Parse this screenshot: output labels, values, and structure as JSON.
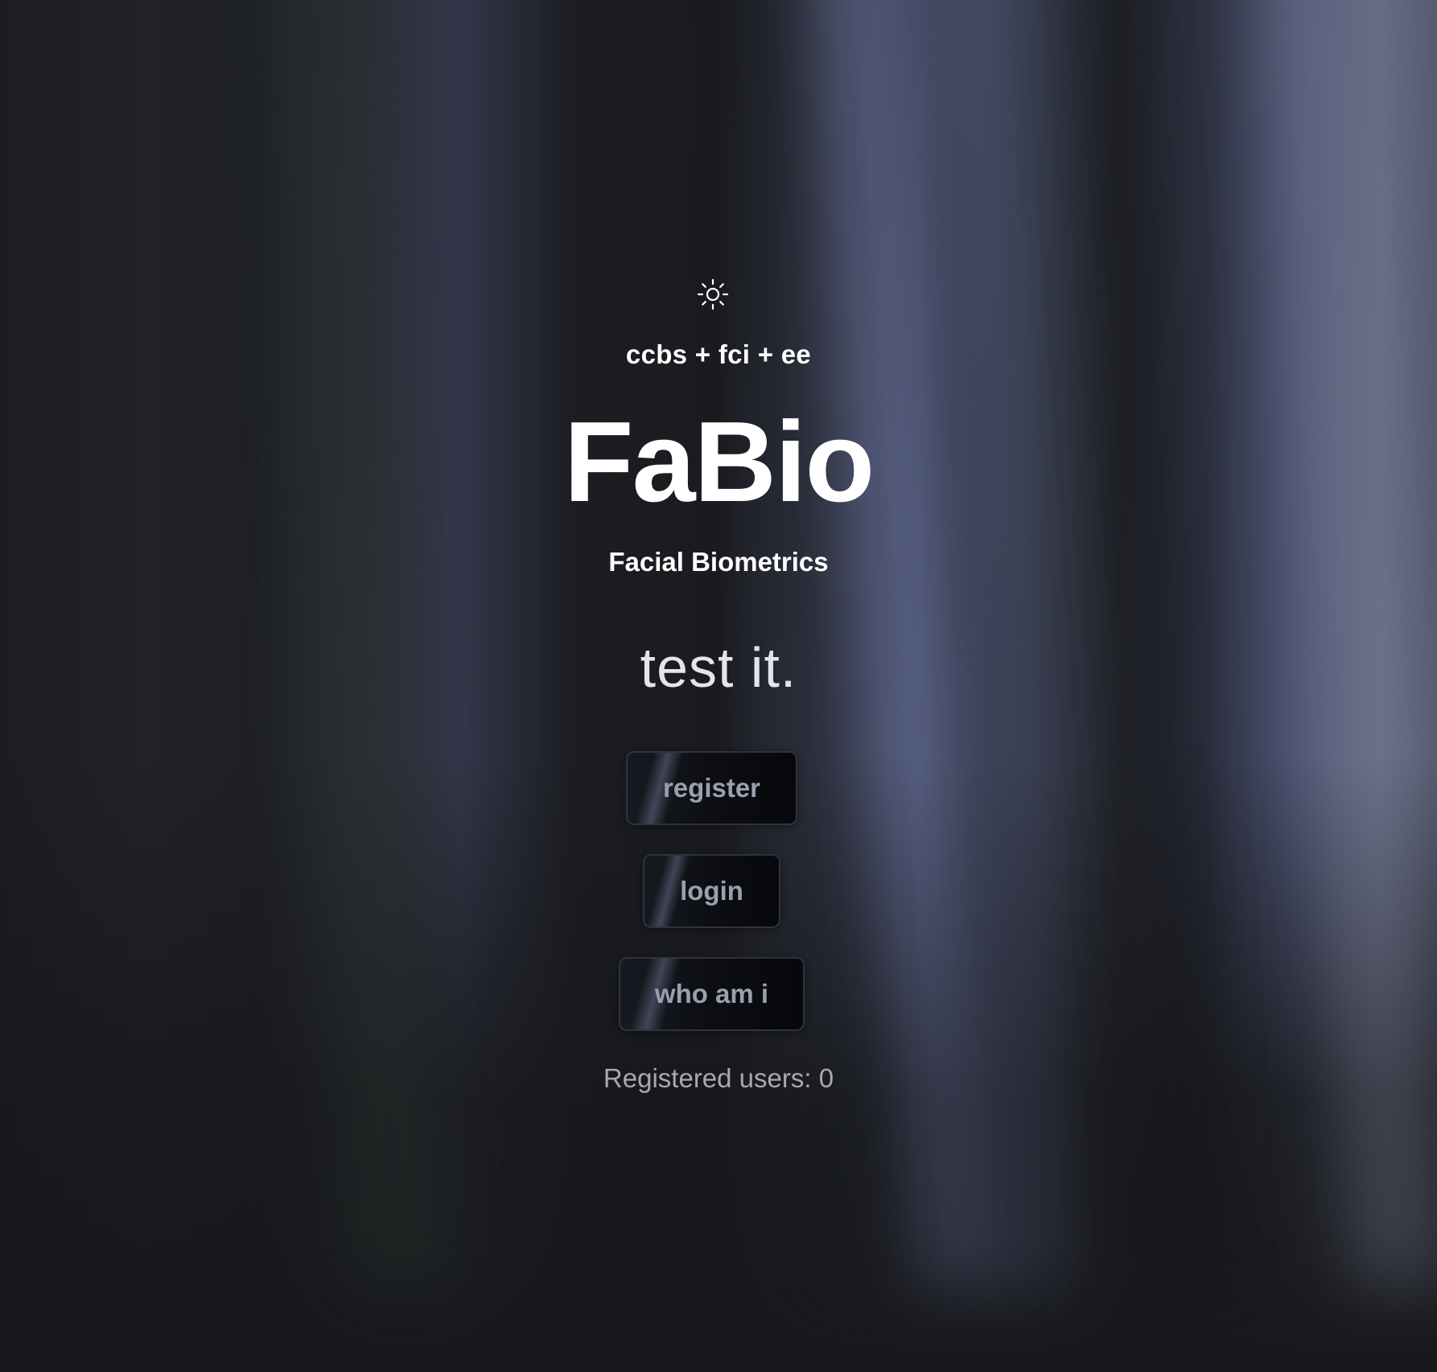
{
  "header": {
    "theme_toggle_icon": "sun-icon",
    "org_line": "ccbs + fci + ee"
  },
  "hero": {
    "title": "FaBio",
    "subtitle": "Facial Biometrics",
    "call_to_action": "test it."
  },
  "actions": {
    "register_label": "register",
    "login_label": "login",
    "whoami_label": "who am i"
  },
  "footer": {
    "registered_users": "Registered users: 0"
  },
  "colors": {
    "background": "#17181b",
    "text_primary": "#ffffff",
    "button_text": "#9aa0ae",
    "muted_text": "#a7a9b0"
  }
}
